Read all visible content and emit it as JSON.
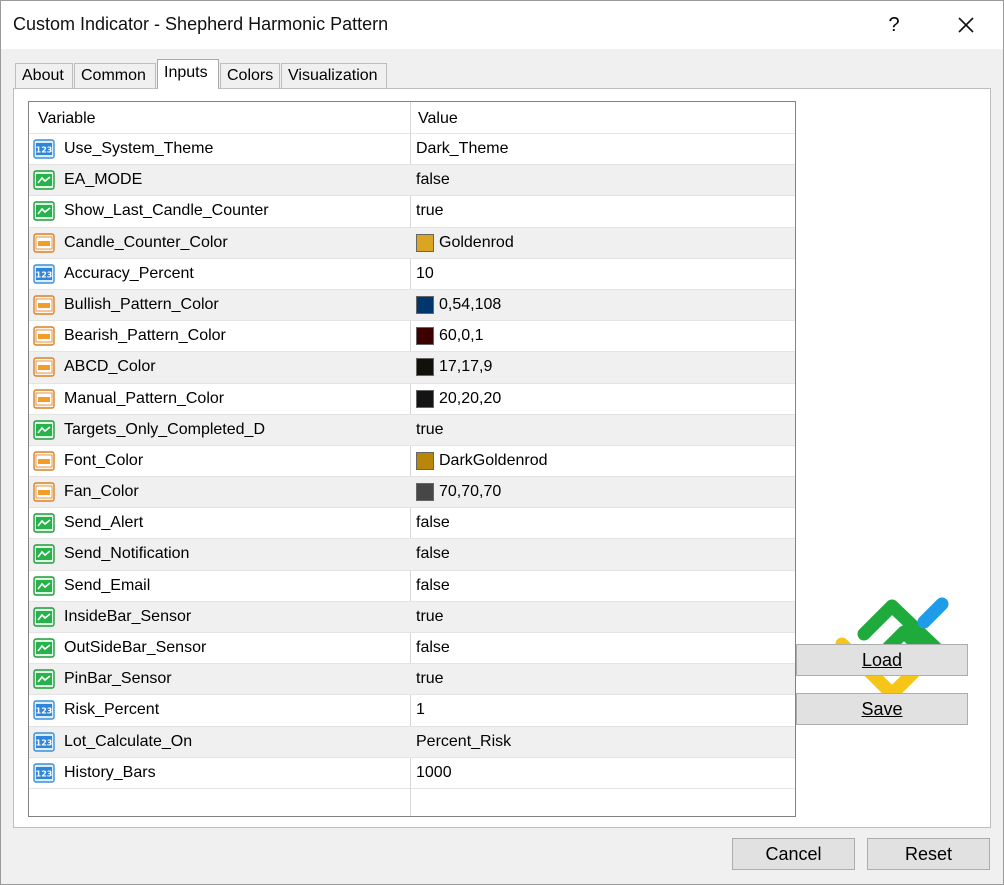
{
  "window": {
    "title": "Custom Indicator - Shepherd Harmonic Pattern",
    "help_label": "?"
  },
  "tabs": [
    "About",
    "Common",
    "Inputs",
    "Colors",
    "Visualization"
  ],
  "active_tab": "Inputs",
  "grid": {
    "headers": {
      "variable": "Variable",
      "value": "Value"
    },
    "rows": [
      {
        "var": "Use_System_Theme",
        "val": "Dark_Theme",
        "icon": "numeric-icon"
      },
      {
        "var": "EA_MODE",
        "val": "false",
        "icon": "boolean-icon"
      },
      {
        "var": "Show_Last_Candle_Counter",
        "val": "true",
        "icon": "boolean-icon"
      },
      {
        "var": "Candle_Counter_Color",
        "val": "Goldenrod",
        "icon": "color-icon",
        "swatch": "#DAA520"
      },
      {
        "var": "Accuracy_Percent",
        "val": "10",
        "icon": "numeric-icon"
      },
      {
        "var": "Bullish_Pattern_Color",
        "val": "0,54,108",
        "icon": "color-icon",
        "swatch": "#00366C"
      },
      {
        "var": "Bearish_Pattern_Color",
        "val": "60,0,1",
        "icon": "color-icon",
        "swatch": "#3C0001"
      },
      {
        "var": "ABCD_Color",
        "val": "17,17,9",
        "icon": "color-icon",
        "swatch": "#111109"
      },
      {
        "var": "Manual_Pattern_Color",
        "val": "20,20,20",
        "icon": "color-icon",
        "swatch": "#141414"
      },
      {
        "var": "Targets_Only_Completed_D",
        "val": "true",
        "icon": "boolean-icon"
      },
      {
        "var": "Font_Color",
        "val": "DarkGoldenrod",
        "icon": "color-icon",
        "swatch": "#B8860B"
      },
      {
        "var": "Fan_Color",
        "val": "70,70,70",
        "icon": "color-icon",
        "swatch": "#464646"
      },
      {
        "var": "Send_Alert",
        "val": "false",
        "icon": "boolean-icon"
      },
      {
        "var": "Send_Notification",
        "val": "false",
        "icon": "boolean-icon"
      },
      {
        "var": "Send_Email",
        "val": "false",
        "icon": "boolean-icon"
      },
      {
        "var": "InsideBar_Sensor",
        "val": "true",
        "icon": "boolean-icon"
      },
      {
        "var": "OutSideBar_Sensor",
        "val": "false",
        "icon": "boolean-icon"
      },
      {
        "var": "PinBar_Sensor",
        "val": "true",
        "icon": "boolean-icon"
      },
      {
        "var": "Risk_Percent",
        "val": "1",
        "icon": "numeric-icon"
      },
      {
        "var": "Lot_Calculate_On",
        "val": "Percent_Risk",
        "icon": "numeric-icon"
      },
      {
        "var": "History_Bars",
        "val": "1000",
        "icon": "numeric-icon"
      }
    ]
  },
  "buttons": {
    "load_label": "Load",
    "save_label": "Save",
    "cancel_label": "Cancel",
    "reset_label": "Reset"
  },
  "colors": {
    "logo_green": "#1faa3c",
    "logo_blue": "#1e9be9",
    "logo_yellow": "#f5c518"
  }
}
